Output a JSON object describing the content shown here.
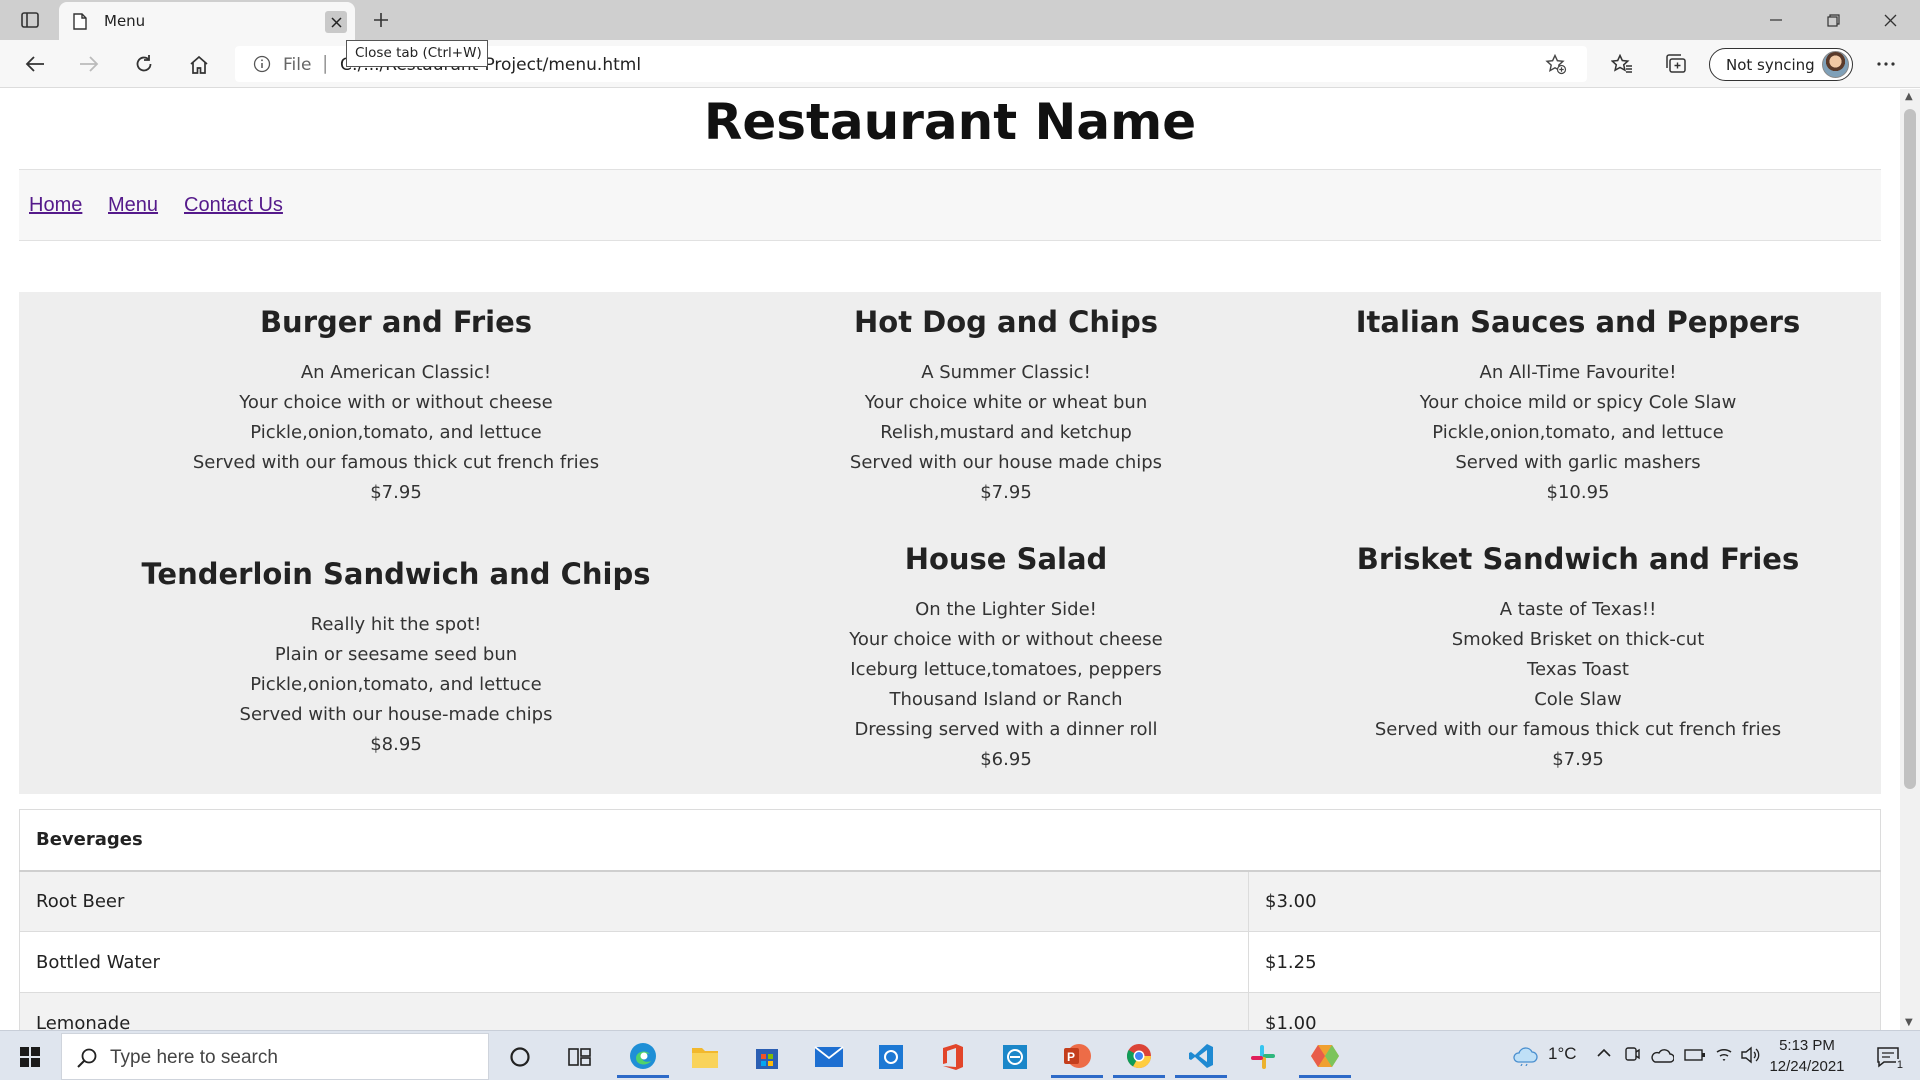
{
  "browser": {
    "tab_title": "Menu",
    "tooltip": "Close tab (Ctrl+W)",
    "address_scheme": "File",
    "address_url": "C:/.../Restaurant-Project/menu.html",
    "sync_label": "Not syncing"
  },
  "site": {
    "title": "Restaurant Name",
    "nav": [
      "Home",
      "Menu",
      "Contact Us"
    ]
  },
  "menu": {
    "dishes": [
      {
        "name": "Burger and Fries",
        "lines": [
          "An American Classic!",
          "Your choice with or without cheese",
          "Pickle,onion,tomato, and lettuce",
          "Served with our famous thick cut french fries"
        ],
        "price": "$7.95"
      },
      {
        "name": "Hot Dog and Chips",
        "lines": [
          "A Summer Classic!",
          "Your choice white or wheat bun",
          "Relish,mustard and ketchup",
          "Served with our house made chips"
        ],
        "price": "$7.95"
      },
      {
        "name": "Italian Sauces and Peppers",
        "lines": [
          "An All-Time Favourite!",
          "Your choice mild or spicy Cole Slaw",
          "Pickle,onion,tomato, and lettuce",
          "Served with garlic mashers"
        ],
        "price": "$10.95"
      },
      {
        "name": "Tenderloin Sandwich and Chips",
        "lines": [
          "Really hit the spot!",
          "Plain or seesame seed bun",
          "Pickle,onion,tomato, and lettuce",
          "Served with our house-made chips"
        ],
        "price": "$8.95"
      },
      {
        "name": "House Salad",
        "lines": [
          "On the Lighter Side!",
          "Your choice with or without cheese",
          "Iceburg lettuce,tomatoes, peppers",
          "Thousand Island or Ranch",
          "Dressing served with a dinner roll"
        ],
        "price": "$6.95"
      },
      {
        "name": "Brisket Sandwich and Fries",
        "lines": [
          "A taste of Texas!!",
          "Smoked Brisket on thick-cut",
          "Texas Toast",
          "Cole Slaw",
          "Served with our famous thick cut french fries"
        ],
        "price": "$7.95"
      }
    ]
  },
  "beverages": {
    "header": "Beverages",
    "rows": [
      {
        "item": "Root Beer",
        "price": "$3.00"
      },
      {
        "item": "Bottled Water",
        "price": "$1.25"
      },
      {
        "item": "Lemonade",
        "price": "$1.00"
      }
    ]
  },
  "taskbar": {
    "search_placeholder": "Type here to search",
    "temperature": "1°C",
    "time": "5:13 PM",
    "date": "12/24/2021",
    "notification_count": "1",
    "pinned_apps": [
      "cortana-icon",
      "task-view-icon",
      "edge-icon",
      "file-explorer-icon",
      "store-icon",
      "mail-icon",
      "photos-icon",
      "office-icon",
      "app-icon",
      "powerpoint-icon",
      "chrome-icon",
      "vscode-icon",
      "slack-icon",
      "git-icon"
    ]
  },
  "colors": {
    "link_visited": "#551a8b",
    "menu_panel_bg": "#eeeeee",
    "taskbar_bg": "#dfe5ee"
  }
}
